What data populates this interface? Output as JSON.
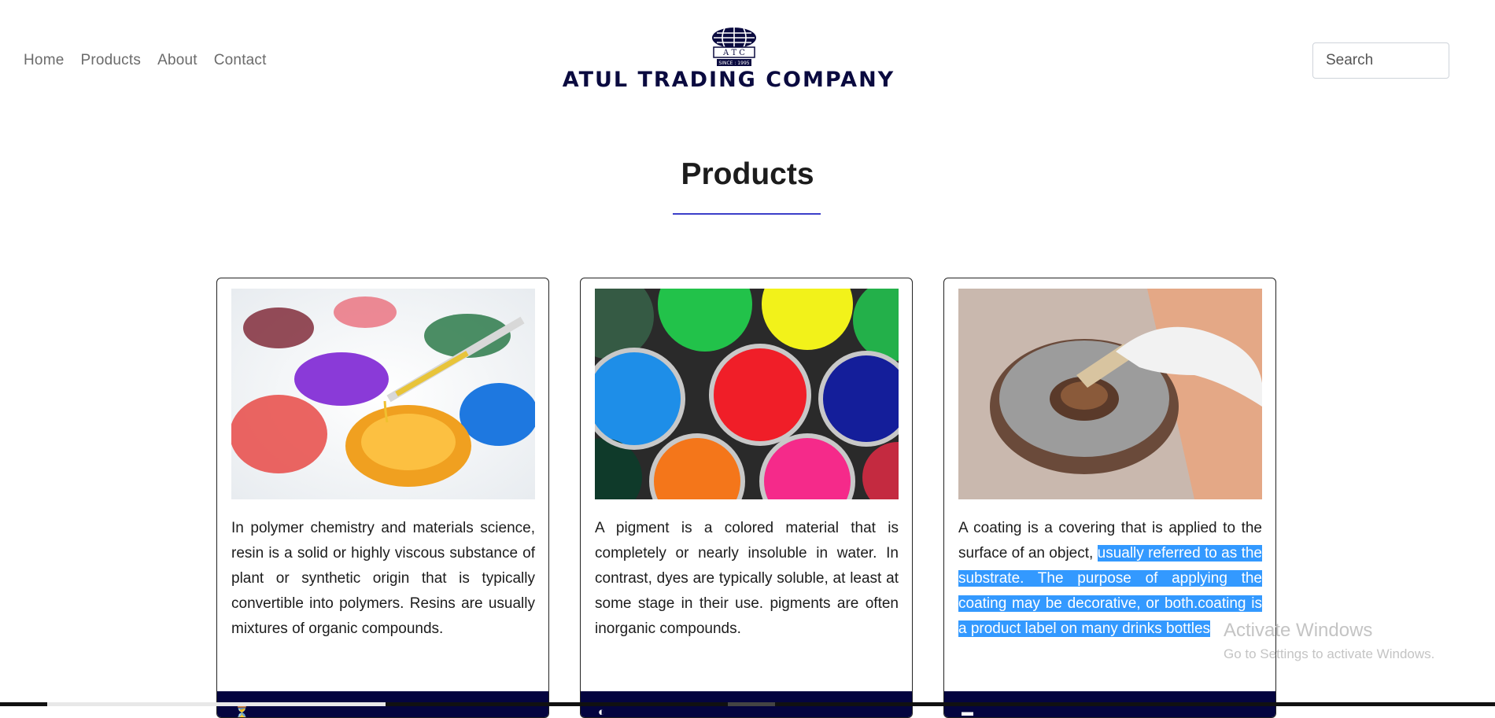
{
  "nav": {
    "home": "Home",
    "products": "Products",
    "about": "About",
    "contact": "Contact"
  },
  "logo": {
    "initials": "A T C",
    "since": "SINCE : 1995",
    "name": "ATUL TRADING COMPANY"
  },
  "search": {
    "placeholder": "Search"
  },
  "heading": {
    "title": "Products"
  },
  "cards": [
    {
      "image": "petri-dishes-resin-image",
      "description": "In polymer chemistry and materials science, resin is a solid or highly viscous substance of plant or synthetic origin that is typically convertible into polymers. Resins are usually mixtures of organic compounds."
    },
    {
      "image": "pigment-jars-image",
      "description": "A pigment is a colored material that is completely or nearly insoluble in water. In contrast, dyes are typically soluble, at least at some stage in their use. pigments are often inorganic compounds."
    },
    {
      "image": "coating-brush-image",
      "description_plain": "A coating is a covering that is applied to the surface of an object, ",
      "description_selected": "usually referred to as the substrate. The purpose of applying the coating may be decorative, or both.coating is a product label on many drinks bottles"
    }
  ],
  "watermark": {
    "line1": "Activate Windows",
    "line2": "Go to Settings to activate Windows."
  },
  "colors": {
    "accent_rule": "#3b3fc9",
    "card_footer": "#04043f",
    "logo_text": "#0a0a3f",
    "selection": "#3399ff"
  }
}
